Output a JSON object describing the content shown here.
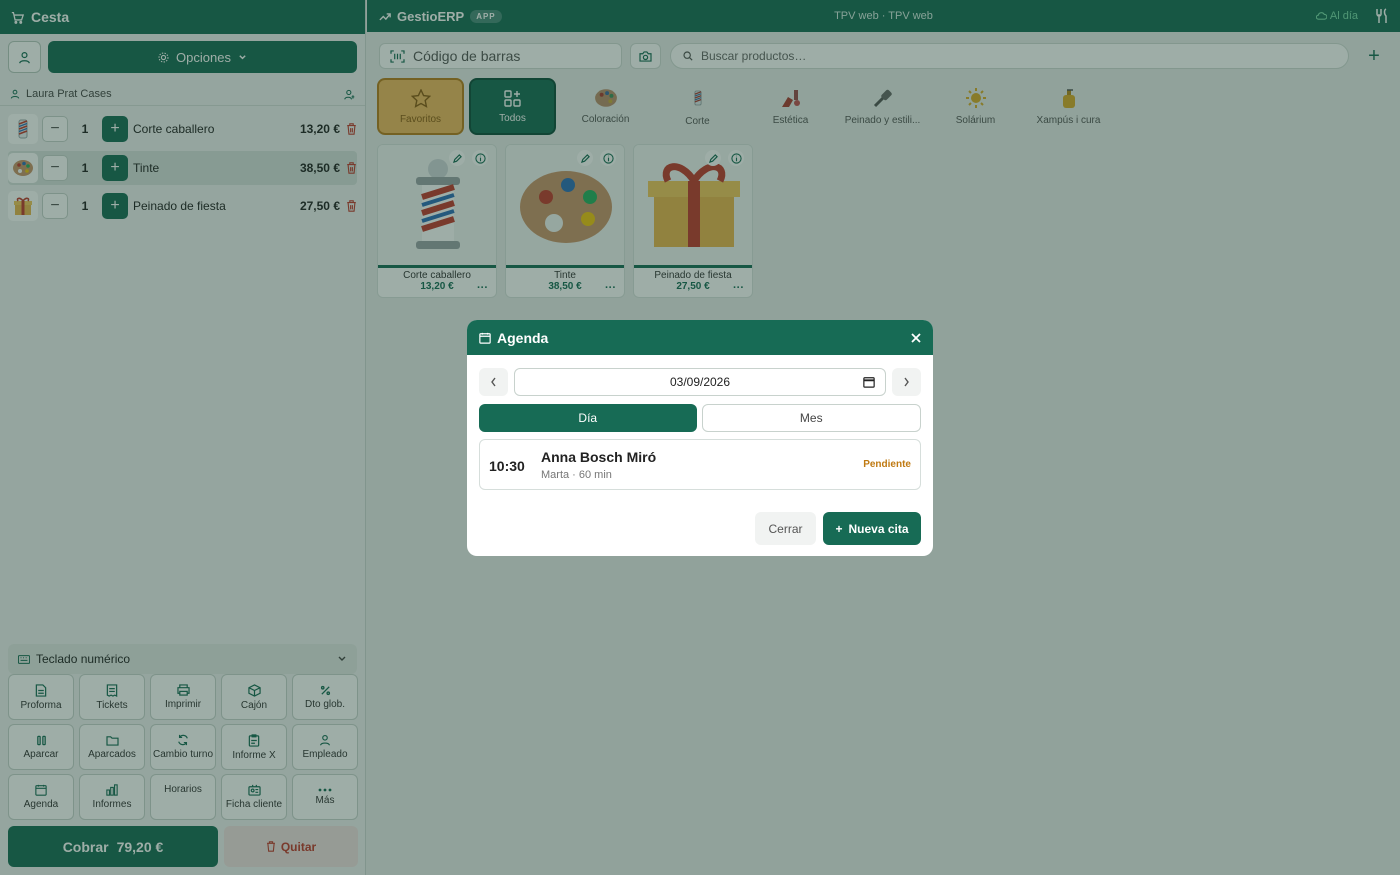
{
  "colors": {
    "accent": "#176b55",
    "favorite": "#f0b95d",
    "status_pending": "#c07a12",
    "delete": "#c0392b"
  },
  "basket": {
    "title": "Cesta",
    "options_label": "Opciones",
    "customer": "Laura Prat Cases",
    "lines": [
      {
        "name": "Corte caballero",
        "qty": "1",
        "price": "13,20 €",
        "icon": "barber-pole-icon"
      },
      {
        "name": "Tinte",
        "qty": "1",
        "price": "38,50 €",
        "icon": "paint-palette-icon",
        "selected": true
      },
      {
        "name": "Peinado de fiesta",
        "qty": "1",
        "price": "27,50 €",
        "icon": "gift-icon"
      }
    ]
  },
  "keypad": {
    "title": "Teclado numérico",
    "buttons": [
      {
        "label": "Proforma",
        "icon": "document-icon"
      },
      {
        "label": "Tickets",
        "icon": "receipt-icon"
      },
      {
        "label": "Imprimir",
        "icon": "printer-icon"
      },
      {
        "label": "Cajón",
        "icon": "box-icon"
      },
      {
        "label": "Dto glob.",
        "icon": "percent-icon"
      },
      {
        "label": "Aparcar",
        "icon": "pause-icon"
      },
      {
        "label": "Aparcados",
        "icon": "folder-icon"
      },
      {
        "label": "Cambio turno",
        "icon": "refresh-icon"
      },
      {
        "label": "Informe X",
        "icon": "clipboard-icon"
      },
      {
        "label": "Empleado",
        "icon": "user-icon"
      },
      {
        "label": "Agenda",
        "icon": "calendar-icon"
      },
      {
        "label": "Informes",
        "icon": "bar-chart-icon"
      },
      {
        "label": "Horarios",
        "icon": ""
      },
      {
        "label": "Ficha cliente",
        "icon": "id-card-icon"
      },
      {
        "label": "Más",
        "icon": "more-icon"
      }
    ]
  },
  "actions": {
    "charge_label": "Cobrar",
    "charge_total": "79,20 €",
    "remove_label": "Quitar"
  },
  "topbar": {
    "brand": "GestioERP",
    "badge": "APP",
    "title": "TPV web · TPV web",
    "sync": "Al día"
  },
  "search": {
    "barcode_placeholder": "Código de barras",
    "product_placeholder": "Buscar productos…"
  },
  "categories": [
    {
      "label": "Favoritos",
      "icon": "star-icon"
    },
    {
      "label": "Todos",
      "icon": "grid-icon"
    },
    {
      "label": "Coloración",
      "icon": "paint-palette-icon"
    },
    {
      "label": "Corte",
      "icon": "barber-pole-icon"
    },
    {
      "label": "Estética",
      "icon": "nail-polish-icon"
    },
    {
      "label": "Peinado y estili...",
      "icon": "hair-brush-icon"
    },
    {
      "label": "Solárium",
      "icon": "sun-icon"
    },
    {
      "label": "Xampús i cura",
      "icon": "shampoo-bottle-icon"
    }
  ],
  "products": [
    {
      "name": "Corte caballero",
      "price": "13,20 €",
      "icon": "barber-pole-icon"
    },
    {
      "name": "Tinte",
      "price": "38,50 €",
      "icon": "paint-palette-icon"
    },
    {
      "name": "Peinado de fiesta",
      "price": "27,50 €",
      "icon": "gift-icon"
    }
  ],
  "modal": {
    "title": "Agenda",
    "date": "03/09/2026",
    "tabs": [
      "Día",
      "Mes"
    ],
    "appointment": {
      "time": "10:30",
      "client": "Anna Bosch Miró",
      "detail": "Marta · 60 min",
      "status": "Pendiente"
    },
    "close_label": "Cerrar",
    "new_label": "Nueva cita"
  }
}
